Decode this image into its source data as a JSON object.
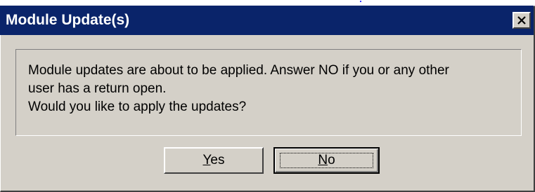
{
  "window": {
    "title": "Module Update(s)",
    "close_icon": "close-icon"
  },
  "message": {
    "line1": "Module updates are about to be applied. Answer NO if you or any other",
    "line2": "user has a return open.",
    "line3": "Would you like to apply the updates?"
  },
  "buttons": {
    "yes": {
      "mnemonic": "Y",
      "rest": "es"
    },
    "no": {
      "mnemonic": "N",
      "rest": "o",
      "focused": true
    }
  },
  "colors": {
    "titlebar": "#0a246a",
    "face": "#d4d0c8"
  }
}
